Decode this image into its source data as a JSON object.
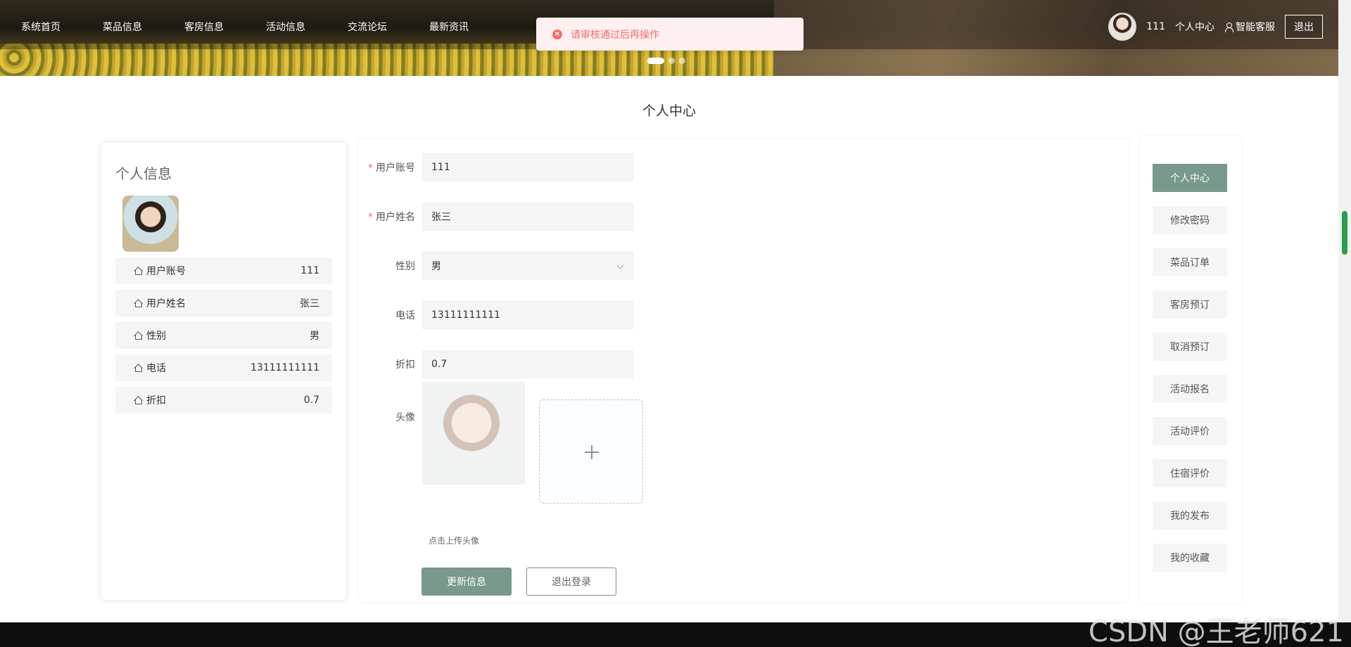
{
  "nav": {
    "items": [
      "系统首页",
      "菜品信息",
      "客房信息",
      "活动信息",
      "交流论坛",
      "最新资讯"
    ]
  },
  "user": {
    "name": "111",
    "center": "个人中心",
    "service": "智能客服",
    "logout": "退出"
  },
  "toast": {
    "message": "请审核通过后再操作",
    "icon": "error-circle-icon"
  },
  "page_title": "个人中心",
  "profile_card": {
    "title": "个人信息",
    "rows": [
      {
        "label": "用户账号",
        "value": "111"
      },
      {
        "label": "用户姓名",
        "value": "张三"
      },
      {
        "label": "性别",
        "value": "男"
      },
      {
        "label": "电话",
        "value": "13111111111"
      },
      {
        "label": "折扣",
        "value": "0.7"
      }
    ]
  },
  "form": {
    "account_label": "用户账号",
    "account_value": "111",
    "name_label": "用户姓名",
    "name_value": "张三",
    "gender_label": "性别",
    "gender_value": "男",
    "phone_label": "电话",
    "phone_value": "13111111111",
    "discount_label": "折扣",
    "discount_value": "0.7",
    "avatar_label": "头像",
    "upload_hint": "点击上传头像",
    "update_button": "更新信息",
    "logout_button": "退出登录"
  },
  "side_menu": {
    "items": [
      "个人中心",
      "修改密码",
      "菜品订单",
      "客房预订",
      "取消预订",
      "活动报名",
      "活动评价",
      "住宿评价",
      "我的发布",
      "我的收藏"
    ],
    "active_index": 0
  },
  "colors": {
    "accent": "#78998b",
    "error": "#f56c6c"
  },
  "watermark": "CSDN @王老师621"
}
